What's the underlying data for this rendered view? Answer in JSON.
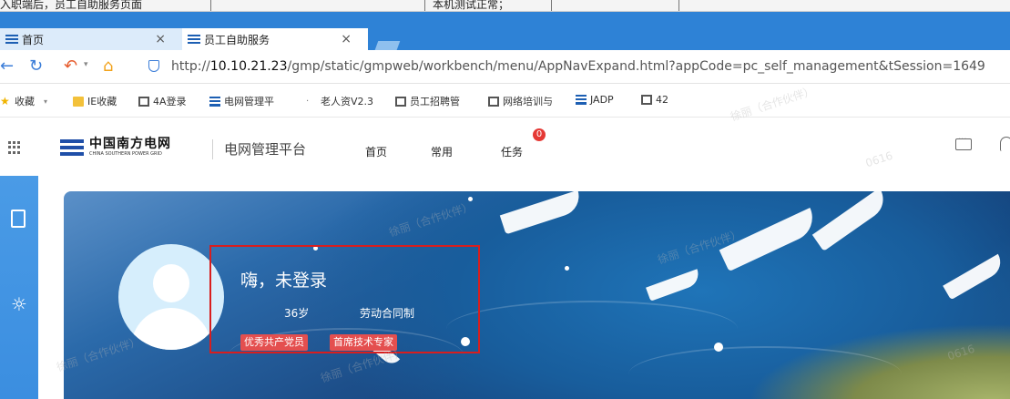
{
  "top_strip": {
    "left_text": "入职端后，员工自助服务页面",
    "mid_text": "本机测试正常；"
  },
  "tabs": [
    {
      "label": "首页",
      "close": "×"
    },
    {
      "label": "员工自助服务",
      "close": "×"
    }
  ],
  "address": {
    "url_prefix": "http://",
    "url_host": "10.10.21.23",
    "url_rest": "/gmp/static/gmpweb/workbench/menu/AppNavExpand.html?appCode=pc_self_management&tSession=1649"
  },
  "bookmarks": [
    {
      "label": "收藏",
      "icon": "star-icon",
      "color": "#f0b400"
    },
    {
      "label": "IE收藏",
      "icon": "folder-icon",
      "color": "#f3c13a"
    },
    {
      "label": "4A登录",
      "icon": "page-icon",
      "color": "#555555"
    },
    {
      "label": "电网管理平",
      "icon": "csg-icon",
      "color": "#1d5fb3"
    },
    {
      "label": "老人资V2.3",
      "icon": "dot-icon",
      "color": "#777777"
    },
    {
      "label": "员工招聘管",
      "icon": "page-icon",
      "color": "#555555"
    },
    {
      "label": "网络培训与",
      "icon": "page-icon",
      "color": "#555555"
    },
    {
      "label": "JADP",
      "icon": "csg-icon",
      "color": "#1d5fb3"
    },
    {
      "label": "42",
      "icon": "page-icon",
      "color": "#555555"
    }
  ],
  "app": {
    "logo_cn": "中国南方电网",
    "logo_en": "CHINA SOUTHERN POWER GRID",
    "platform": "电网管理平台",
    "menu": [
      "首页",
      "常用",
      "任务"
    ],
    "task_badge": "0"
  },
  "user": {
    "greeting": "嗨，未登录",
    "age": "36岁",
    "contract": "劳动合同制",
    "tags": [
      "优秀共产党员",
      "首席技术专家"
    ]
  },
  "watermark": {
    "text": "徐丽（合作伙伴）",
    "code": "0616"
  },
  "colors": {
    "accent": "#2e82d6",
    "badge": "#e53935",
    "tag": "#e44f4f",
    "highlight": "#d81e1e"
  }
}
